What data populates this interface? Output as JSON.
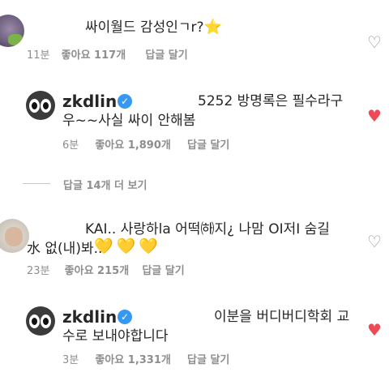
{
  "comments": [
    {
      "text": "싸이월드 감성인ㄱr?",
      "star": "⭐",
      "time": "11분",
      "likes_label": "좋아요 117개",
      "reply_label": "답글 달기",
      "liked": false
    },
    {
      "username": "zkdlin",
      "text_line1": "5252 방명록은 필수라구",
      "text_line2": "우~~사실 싸이 안해봄",
      "time": "6분",
      "likes_label": "좋아요 1,890개",
      "reply_label": "답글 달기",
      "liked": true
    },
    {
      "text_line1": "KAI.. 사랑하la 어떡㈛지¿ 나맘 OI저I 숨길",
      "text_line2": "水 없(내)봐...",
      "hearts": "💛💛💛",
      "time": "23분",
      "likes_label": "좋아요 215개",
      "reply_label": "답글 달기",
      "liked": false
    },
    {
      "username": "zkdlin",
      "text_line1": "이분을 버디버디학회 교",
      "text_line2": "수로 보내야합니다",
      "time": "3분",
      "likes_label": "좋아요 1,331개",
      "reply_label": "답글 달기",
      "liked": true
    }
  ],
  "view_replies_label": "답글 14개 더 보기",
  "icons": {
    "verified": "verified-badge-icon",
    "heart": "heart-icon"
  },
  "colors": {
    "liked": "#ed4956",
    "meta": "#8e8e8e",
    "verified": "#3897f0"
  }
}
